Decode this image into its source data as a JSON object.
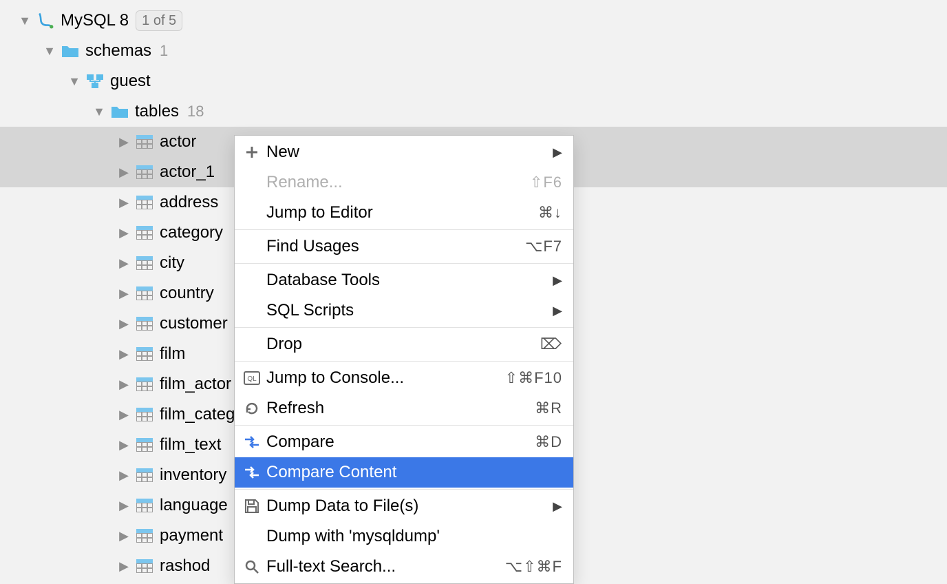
{
  "tree": {
    "root": {
      "label": "MySQL 8",
      "badge": "1 of 5"
    },
    "schemas": {
      "label": "schemas",
      "count": "1"
    },
    "schema": {
      "label": "guest"
    },
    "tables": {
      "label": "tables",
      "count": "18"
    },
    "items": [
      "actor",
      "actor_1",
      "address",
      "category",
      "city",
      "country",
      "customer",
      "film",
      "film_actor",
      "film_category",
      "film_text",
      "inventory",
      "language",
      "payment",
      "rashod"
    ],
    "selected_indices": [
      0,
      1
    ]
  },
  "menu": {
    "items": [
      {
        "icon": "plus",
        "label": "New",
        "submenu": true
      },
      {
        "label": "Rename...",
        "shortcut": "⇧F6",
        "disabled": true
      },
      {
        "label": "Jump to Editor",
        "shortcut": "⌘↓"
      },
      {
        "sep": true
      },
      {
        "label": "Find Usages",
        "shortcut": "⌥F7"
      },
      {
        "sep": true
      },
      {
        "label": "Database Tools",
        "submenu": true
      },
      {
        "label": "SQL Scripts",
        "submenu": true
      },
      {
        "sep": true
      },
      {
        "label": "Drop",
        "shortcut": "⌦"
      },
      {
        "sep": true
      },
      {
        "icon": "console",
        "label": "Jump to Console...",
        "shortcut": "⇧⌘F10"
      },
      {
        "icon": "refresh",
        "label": "Refresh",
        "shortcut": "⌘R"
      },
      {
        "sep": true
      },
      {
        "icon": "compare",
        "label": "Compare",
        "shortcut": "⌘D"
      },
      {
        "icon": "compare",
        "label": "Compare Content",
        "highlight": true
      },
      {
        "sep": true
      },
      {
        "icon": "save",
        "label": "Dump Data to File(s)",
        "submenu": true
      },
      {
        "label": "Dump with 'mysqldump'"
      },
      {
        "icon": "search",
        "label": "Full-text Search...",
        "shortcut": "⌥⇧⌘F"
      }
    ]
  }
}
